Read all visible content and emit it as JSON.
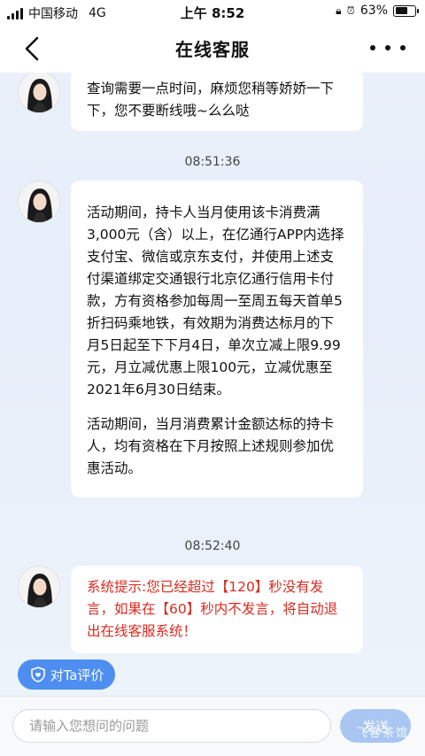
{
  "status_bar": {
    "carrier": "中国移动",
    "network": "4G",
    "time": "上午 8:52",
    "battery_percent": "63%",
    "battery_level": 0.63,
    "icons": [
      "signal-icon",
      "orientation-lock-icon",
      "alarm-icon",
      "battery-icon"
    ]
  },
  "nav": {
    "title": "在线客服",
    "back_icon": "chevron-left-icon",
    "more_icon": "more-dots-icon"
  },
  "messages": [
    {
      "type": "agent",
      "paragraphs": [
        "查询需要一点时间，麻烦您稍等娇娇一下下，您不要断线哦~么么哒"
      ]
    },
    {
      "type": "timestamp",
      "text": "08:51:36"
    },
    {
      "type": "agent",
      "paragraphs": [
        "活动期间，持卡人当月使用该卡消费满3,000元（含）以上，在亿通行APP内选择支付宝、微信或京东支付，并使用上述支付渠道绑定交通银行北京亿通行信用卡付款，方有资格参加每周一至周五每天首单5折扫码乘地铁，有效期为消费达标月的下月5日起至下下月4日，单次立减上限9.99元，月立减优惠上限100元，立减优惠至2021年6月30日结束。",
        "活动期间，当月消费累计金额达标的持卡人，均有资格在下月按照上述规则参加优惠活动。"
      ]
    },
    {
      "type": "timestamp",
      "text": "08:52:40"
    },
    {
      "type": "system",
      "paragraphs": [
        "系统提示:您已经超过【120】秒没有发言，如果在【60】秒内不发言，将自动退出在线客服系统！"
      ]
    }
  ],
  "rate_button": {
    "label": "对Ta评价",
    "icon": "heart-shield-icon"
  },
  "input": {
    "placeholder": "请输入您想问的问题",
    "value": ""
  },
  "send_button": {
    "label": "发送"
  },
  "watermark": "飞客茶馆",
  "colors": {
    "accent": "#4d8ef0",
    "system_text": "#d92b20",
    "send_disabled": "#a9c6f2"
  }
}
